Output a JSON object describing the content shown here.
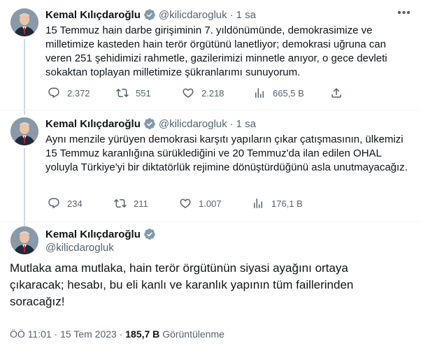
{
  "author": {
    "name": "Kemal Kılıçdaroğlu",
    "handle": "@kilicdarogluk",
    "verified_color": "#829aab"
  },
  "tweets": [
    {
      "time": "1 sa",
      "text": "15 Temmuz hain darbe girişiminin 7. yıldönümünde, demokrasimize ve milletimize kasteden hain terör örgütünü lanetliyor; demokrasi uğruna can veren 251 şehidimizi rahmetle, gazilerimizi minnetle anıyor, o gece devleti sokaktan toplayan milletimize şükranlarımı sunuyorum.",
      "replies": "2.372",
      "retweets": "551",
      "likes": "2.218",
      "views": "665,5 B"
    },
    {
      "time": "1 sa",
      "text": "Aynı menzile yürüyen demokrasi karşıtı yapıların çıkar çatışmasının, ülkemizi 15 Temmuz karanlığına sürüklediğini ve 20 Temmuz'da ilan edilen OHAL yoluyla Türkiye'yi bir diktatörlük rejimine dönüştürdüğünü asla unutmayacağız.",
      "replies": "234",
      "retweets": "211",
      "likes": "1.007",
      "views": "176,1 B"
    }
  ],
  "main_tweet": {
    "text": "Mutlaka ama mutlaka, hain terör örgütünün siyasi ayağını ortaya çıkaracak; hesabı, bu eli kanlı ve karanlık yapının tüm faillerinden soracağız!",
    "timestamp": "ÖÖ 11:01 · 15 Tem 2023",
    "separator": " · ",
    "views_count": "185,7 B",
    "views_label": "Görüntülenme"
  },
  "colors": {
    "text": "#0f1419",
    "secondary": "#536471",
    "thread_line": "#cfd9de",
    "border": "#eff3f4"
  },
  "icons": [
    "more-icon",
    "reply-icon",
    "retweet-icon",
    "like-icon",
    "views-icon",
    "share-icon",
    "verified-badge-icon"
  ]
}
